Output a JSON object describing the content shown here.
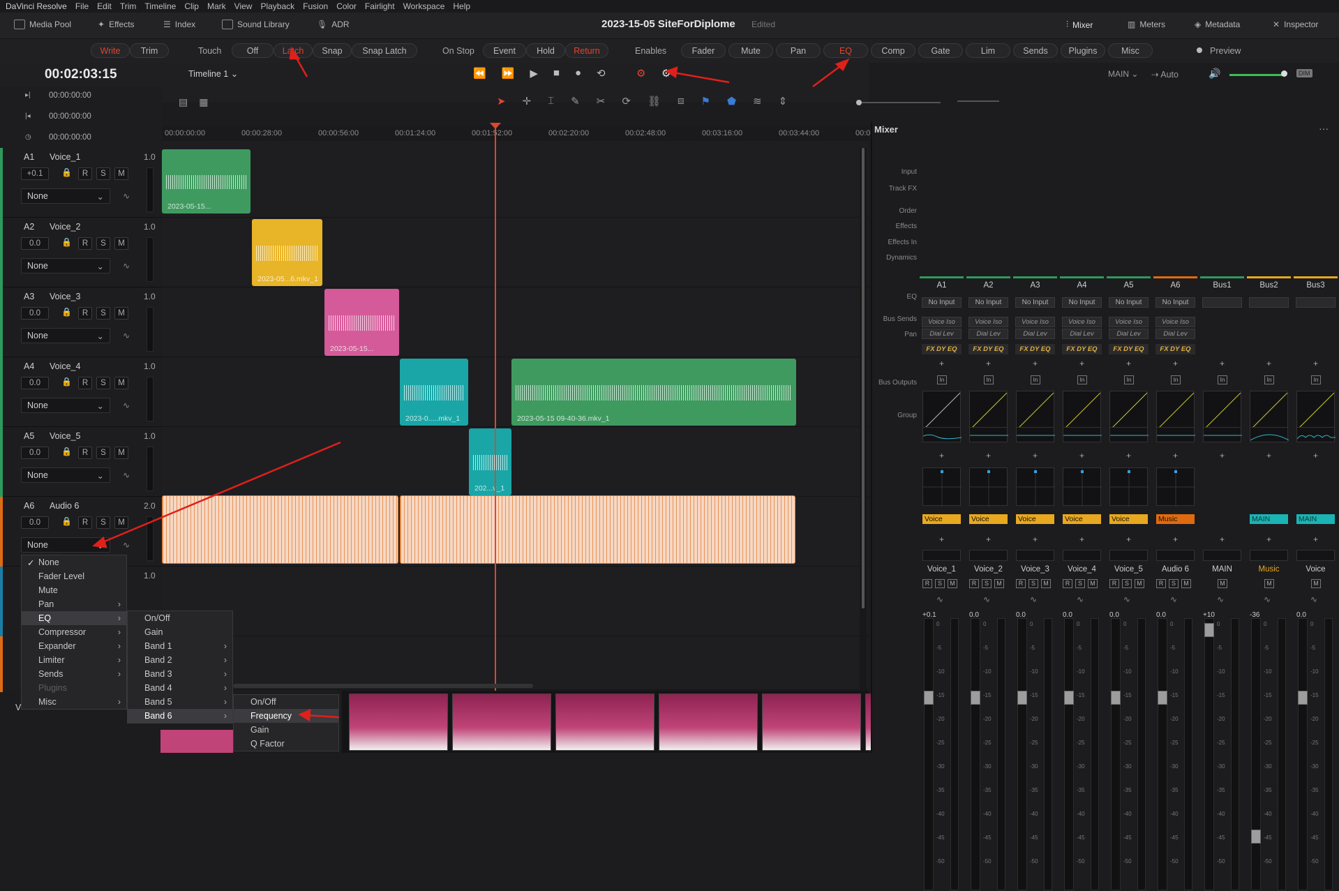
{
  "menubar": {
    "app": "DaVinci Resolve",
    "items": [
      "File",
      "Edit",
      "Trim",
      "Timeline",
      "Clip",
      "Mark",
      "View",
      "Playback",
      "Fusion",
      "Color",
      "Fairlight",
      "Workspace",
      "Help"
    ]
  },
  "toolbar": {
    "media_pool": "Media Pool",
    "effects": "Effects",
    "index": "Index",
    "sound_library": "Sound Library",
    "adr": "ADR",
    "project_title": "2023-15-05 SiteForDiplome",
    "edited": "Edited",
    "mixer": "Mixer",
    "meters": "Meters",
    "metadata": "Metadata",
    "inspector": "Inspector"
  },
  "automation": {
    "write": "Write",
    "trim": "Trim",
    "touch": "Touch",
    "off": "Off",
    "latch": "Latch",
    "snap": "Snap",
    "snap_latch": "Snap Latch",
    "on_stop": "On Stop",
    "event": "Event",
    "hold": "Hold",
    "return": "Return",
    "enables": "Enables",
    "fader": "Fader",
    "mute": "Mute",
    "pan": "Pan",
    "eq": "EQ",
    "comp": "Comp",
    "gate": "Gate",
    "lim": "Lim",
    "sends": "Sends",
    "plugins": "Plugins",
    "misc": "Misc",
    "preview": "Preview"
  },
  "transport": {
    "timecode": "00:02:03:15",
    "timeline": "Timeline 1",
    "tc_in": "00:00:00:00",
    "tc_out": "00:00:00:00",
    "tc_dur": "00:00:00:00",
    "main": "MAIN",
    "auto": "Auto",
    "dim": "DIM"
  },
  "ruler": [
    "00:00:00:00",
    "00:00:28:00",
    "00:00:56:00",
    "00:01:24:00",
    "00:01:52:00",
    "00:02:20:00",
    "00:02:48:00",
    "00:03:16:00",
    "00:03:44:00",
    "00:0"
  ],
  "tracks": [
    {
      "id": "A1",
      "name": "Voice_1",
      "vol": "1.0",
      "gain": "+0.1",
      "mode": "None",
      "color": "#2d9a5b"
    },
    {
      "id": "A2",
      "name": "Voice_2",
      "vol": "1.0",
      "gain": "0.0",
      "mode": "None",
      "color": "#2d9a5b"
    },
    {
      "id": "A3",
      "name": "Voice_3",
      "vol": "1.0",
      "gain": "0.0",
      "mode": "None",
      "color": "#2d9a5b"
    },
    {
      "id": "A4",
      "name": "Voice_4",
      "vol": "1.0",
      "gain": "0.0",
      "mode": "None",
      "color": "#2d9a5b"
    },
    {
      "id": "A5",
      "name": "Voice_5",
      "vol": "1.0",
      "gain": "0.0",
      "mode": "None",
      "color": "#2d9a5b"
    },
    {
      "id": "A6",
      "name": "Audio 6",
      "vol": "2.0",
      "gain": "0.0",
      "mode": "None",
      "color": "#e06a10"
    }
  ],
  "track7_vol": "1.0",
  "track_buttons": {
    "r": "R",
    "s": "S",
    "m": "M"
  },
  "clips": {
    "c1": "2023-05-15...",
    "c2": "2023-05...6.mkv_1",
    "c3": "2023-05-15...",
    "c4": "2023-0.....mkv_1",
    "c5": "2023-05-15 09-40-36.mkv_1",
    "c6": "202...v_1"
  },
  "dropdown1": {
    "items": [
      "None",
      "Fader Level",
      "Mute",
      "Pan",
      "EQ",
      "Compressor",
      "Expander",
      "Limiter",
      "Sends",
      "Plugins",
      "Misc"
    ],
    "checked": "None",
    "highlight": "EQ"
  },
  "dropdown2": {
    "items": [
      "On/Off",
      "Gain",
      "Band 1",
      "Band 2",
      "Band 3",
      "Band 4",
      "Band 5",
      "Band 6"
    ],
    "highlight": "Band 6"
  },
  "dropdown3": {
    "items": [
      "On/Off",
      "Frequency",
      "Gain",
      "Q Factor"
    ],
    "highlight": "Frequency"
  },
  "footer_letter": "V",
  "mixer": {
    "title": "Mixer",
    "row_labels": {
      "input": "Input",
      "track_fx": "Track FX",
      "order": "Order",
      "effects": "Effects",
      "effects_in": "Effects In",
      "dynamics": "Dynamics",
      "eq": "EQ",
      "bus_sends": "Bus Sends",
      "pan": "Pan",
      "bus_outputs": "Bus Outputs",
      "group": "Group"
    },
    "order_label": "FX DY EQ",
    "fx1": "Voice Iso",
    "fx2": "Dial Lev",
    "plus": "+",
    "effects_in": "In",
    "channels": [
      {
        "id": "A1",
        "input": "No Input",
        "fx": true,
        "order": true,
        "out": "Voice",
        "outColor": "#e8a820",
        "name": "Voice_1",
        "btns": "R S M",
        "gain": "+0.1",
        "knob": 0.28,
        "hdr": "#2d9a5b"
      },
      {
        "id": "A2",
        "input": "No Input",
        "fx": true,
        "order": true,
        "out": "Voice",
        "outColor": "#e8a820",
        "name": "Voice_2",
        "btns": "R S M",
        "gain": "0.0",
        "knob": 0.28,
        "hdr": "#2d9a5b"
      },
      {
        "id": "A3",
        "input": "No Input",
        "fx": true,
        "order": true,
        "out": "Voice",
        "outColor": "#e8a820",
        "name": "Voice_3",
        "btns": "R S M",
        "gain": "0.0",
        "knob": 0.28,
        "hdr": "#2d9a5b"
      },
      {
        "id": "A4",
        "input": "No Input",
        "fx": true,
        "order": true,
        "out": "Voice",
        "outColor": "#e8a820",
        "name": "Voice_4",
        "btns": "R S M",
        "gain": "0.0",
        "knob": 0.28,
        "hdr": "#2d9a5b"
      },
      {
        "id": "A5",
        "input": "No Input",
        "fx": true,
        "order": true,
        "out": "Voice",
        "outColor": "#e8a820",
        "name": "Voice_5",
        "btns": "R S M",
        "gain": "0.0",
        "knob": 0.28,
        "hdr": "#2d9a5b"
      },
      {
        "id": "A6",
        "input": "No Input",
        "fx": true,
        "order": true,
        "out": "Music",
        "outColor": "#e06a10",
        "name": "Audio 6",
        "btns": "R S M",
        "gain": "0.0",
        "knob": 0.28,
        "hdr": "#e06a10"
      },
      {
        "id": "Bus1",
        "input": "",
        "fx": false,
        "order": false,
        "out": "",
        "outColor": "",
        "name": "MAIN",
        "btns": "M",
        "gain": "+10",
        "knob": 0.02,
        "hdr": "#2d9a5b"
      },
      {
        "id": "Bus2",
        "input": "",
        "fx": false,
        "order": false,
        "out": "MAIN",
        "outColor": "#1bb3b3",
        "name": "Music",
        "btns": "M",
        "gain": "-36",
        "knob": 0.82,
        "hdr": "#e8a820"
      },
      {
        "id": "Bus3",
        "input": "",
        "fx": false,
        "order": false,
        "out": "MAIN",
        "outColor": "#1bb3b3",
        "name": "Voice",
        "btns": "M",
        "gain": "0.0",
        "knob": 0.28,
        "hdr": "#e8a820"
      }
    ],
    "scale": [
      "0",
      "-5",
      "-10",
      "-15",
      "-20",
      "-25",
      "-30",
      "-35",
      "-40",
      "-45",
      "-50"
    ]
  }
}
